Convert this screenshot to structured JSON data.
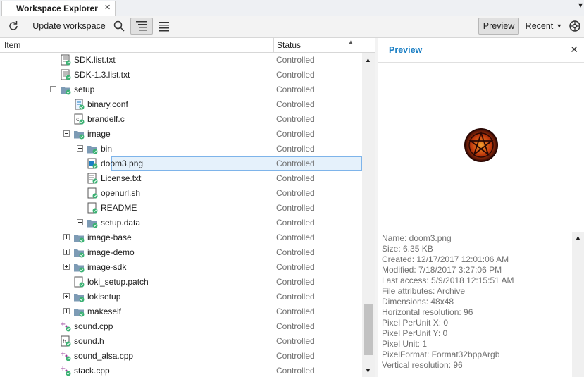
{
  "tab": {
    "title": "Workspace Explorer",
    "close": "✕"
  },
  "toolbar": {
    "update_label": "Update workspace",
    "preview_label": "Preview",
    "recent_label": "Recent",
    "recent_arrow": "▾",
    "menu_arrow": "▾"
  },
  "columns": {
    "item": "Item",
    "status": "Status",
    "sort_indicator": "▲"
  },
  "tree": [
    {
      "name": "SDK.list.txt",
      "status": "Controlled",
      "depth": 0,
      "expander": "none",
      "icon": "text-file-icon"
    },
    {
      "name": "SDK-1.3.list.txt",
      "status": "Controlled",
      "depth": 0,
      "expander": "none",
      "icon": "text-file-icon"
    },
    {
      "name": "setup",
      "status": "Controlled",
      "depth": 0,
      "expander": "minus",
      "icon": "folder-icon"
    },
    {
      "name": "binary.conf",
      "status": "Controlled",
      "depth": 1,
      "expander": "none",
      "icon": "config-file-icon"
    },
    {
      "name": "brandelf.c",
      "status": "Controlled",
      "depth": 1,
      "expander": "none",
      "icon": "c-file-icon"
    },
    {
      "name": "image",
      "status": "Controlled",
      "depth": 1,
      "expander": "minus",
      "icon": "folder-icon"
    },
    {
      "name": "bin",
      "status": "Controlled",
      "depth": 2,
      "expander": "plus",
      "icon": "folder-icon"
    },
    {
      "name": "doom3.png",
      "status": "Controlled",
      "depth": 2,
      "expander": "none",
      "icon": "image-file-icon",
      "selected": true
    },
    {
      "name": "License.txt",
      "status": "Controlled",
      "depth": 2,
      "expander": "none",
      "icon": "text-file-icon"
    },
    {
      "name": "openurl.sh",
      "status": "Controlled",
      "depth": 2,
      "expander": "none",
      "icon": "generic-file-icon"
    },
    {
      "name": "README",
      "status": "Controlled",
      "depth": 2,
      "expander": "none",
      "icon": "generic-file-icon"
    },
    {
      "name": "setup.data",
      "status": "Controlled",
      "depth": 2,
      "expander": "plus",
      "icon": "folder-icon"
    },
    {
      "name": "image-base",
      "status": "Controlled",
      "depth": 1,
      "expander": "plus",
      "icon": "folder-icon"
    },
    {
      "name": "image-demo",
      "status": "Controlled",
      "depth": 1,
      "expander": "plus",
      "icon": "folder-icon"
    },
    {
      "name": "image-sdk",
      "status": "Controlled",
      "depth": 1,
      "expander": "plus",
      "icon": "folder-icon"
    },
    {
      "name": "loki_setup.patch",
      "status": "Controlled",
      "depth": 1,
      "expander": "none",
      "icon": "generic-file-icon"
    },
    {
      "name": "lokisetup",
      "status": "Controlled",
      "depth": 1,
      "expander": "plus",
      "icon": "folder-icon"
    },
    {
      "name": "makeself",
      "status": "Controlled",
      "depth": 1,
      "expander": "plus",
      "icon": "folder-icon"
    },
    {
      "name": "sound.cpp",
      "status": "Controlled",
      "depth": 0,
      "expander": "none",
      "icon": "cpp-file-icon"
    },
    {
      "name": "sound.h",
      "status": "Controlled",
      "depth": 0,
      "expander": "none",
      "icon": "header-file-icon"
    },
    {
      "name": "sound_alsa.cpp",
      "status": "Controlled",
      "depth": 0,
      "expander": "none",
      "icon": "cpp-file-icon"
    },
    {
      "name": "stack.cpp",
      "status": "Controlled",
      "depth": 0,
      "expander": "none",
      "icon": "cpp-file-icon"
    }
  ],
  "preview": {
    "title": "Preview",
    "close": "✕",
    "info": [
      "Name: doom3.png",
      "Size: 6.35 KB",
      "Created: 12/17/2017 12:01:06 AM",
      "Modified: 7/18/2017 3:27:06 PM",
      "Last access: 5/9/2018 12:15:51 AM",
      "File attributes: Archive",
      "Dimensions: 48x48",
      "Horizontal resolution: 96",
      "Pixel PerUnit X: 0",
      "Pixel PerUnit Y: 0",
      "Pixel Unit: 1",
      "PixelFormat: Format32bppArgb",
      "Vertical resolution: 96"
    ]
  },
  "colors": {
    "accent": "#1b7fc4",
    "folder": "#7d9bb5",
    "badge": "#3bb273",
    "selection_fill": "#e5f1fb",
    "selection_border": "#7eb4ea"
  }
}
